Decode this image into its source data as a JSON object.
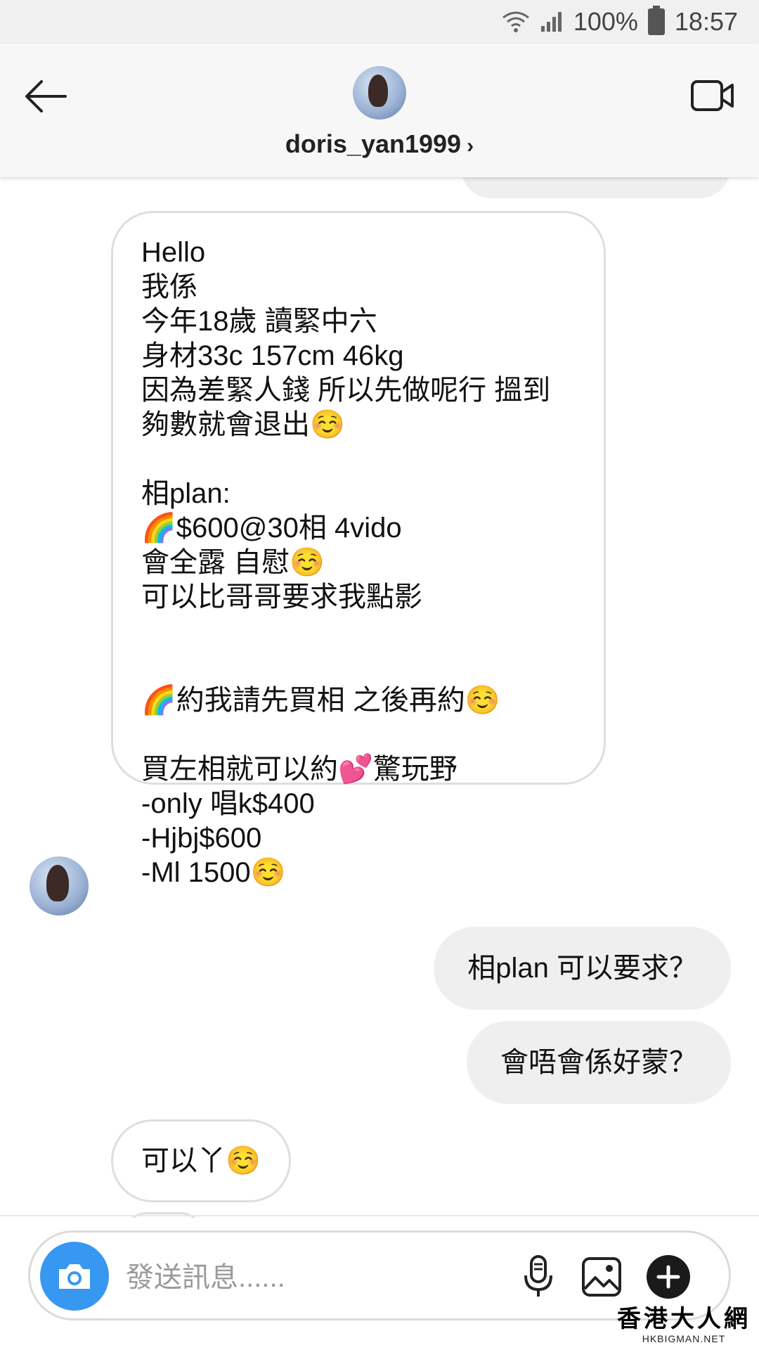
{
  "status_bar": {
    "battery": "100%",
    "time": "18:57"
  },
  "header": {
    "username": "doris_yan1999",
    "chevron": "›"
  },
  "messages": [
    {
      "direction": "incoming",
      "lines": [
        "Hello",
        "我係",
        "今年18歲 讀緊中六",
        "身材33c 157cm 46kg",
        "因為差緊人錢 所以先做呢行 搵到",
        "夠數就會退出☺️",
        "",
        "相plan:",
        "🌈$600@30相 4vido",
        "會全露 自慰☺️",
        "可以比哥哥要求我點影",
        "",
        "",
        "🌈約我請先買相 之後再約☺️",
        "",
        "買左相就可以約💕驚玩野",
        "-only 唱k$400",
        "-Hjbj$600",
        "-Ml 1500☺️"
      ]
    },
    {
      "direction": "outgoing",
      "text": "相plan 可以要求？"
    },
    {
      "direction": "outgoing",
      "text": "會唔會係好蒙？"
    },
    {
      "direction": "incoming",
      "text": "可以丫☺️"
    }
  ],
  "composer": {
    "placeholder": "發送訊息......"
  },
  "icons": {
    "status": [
      "wifi-icon",
      "signal-icon",
      "battery-icon"
    ],
    "header": [
      "back-arrow-icon",
      "video-call-icon"
    ],
    "composer": [
      "camera-icon",
      "microphone-icon",
      "gallery-icon",
      "plus-icon"
    ]
  },
  "watermark": {
    "cn": "香港大人網",
    "en": "HKBIGMAN.NET"
  },
  "colors": {
    "camera_button": "#3897f0",
    "outgoing_bubble": "#efefef",
    "incoming_border": "#dedede"
  }
}
